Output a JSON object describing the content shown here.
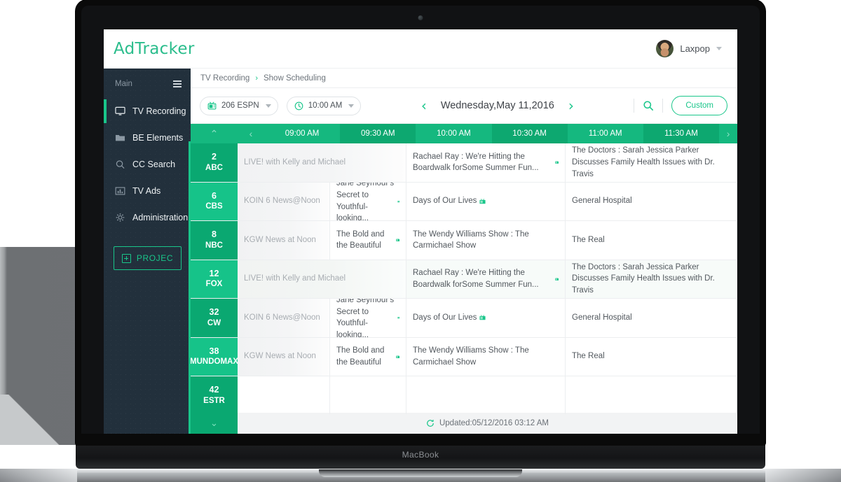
{
  "device": {
    "brand": "MacBook"
  },
  "topbar": {
    "logo": "AdTracker",
    "user_name": "Laxpop",
    "avatar_icon": "user-avatar-photo",
    "caret_icon": "chevron-down-icon"
  },
  "sidebar": {
    "section_label": "Main",
    "menu_icon": "hamburger-menu-icon",
    "items": [
      {
        "label": "TV Recording",
        "icon": "monitor-icon",
        "active": true
      },
      {
        "label": "BE Elements",
        "icon": "folder-icon",
        "active": false
      },
      {
        "label": "CC Search",
        "icon": "search-icon",
        "active": false
      },
      {
        "label": "TV Ads",
        "icon": "chart-bar-icon",
        "active": false
      },
      {
        "label": "Administration",
        "icon": "gear-icon",
        "active": false
      }
    ],
    "project_button": {
      "label": "PROJEC",
      "icon": "plus-box-icon"
    }
  },
  "breadcrumb": {
    "items": [
      "TV Recording",
      "Show Scheduling"
    ],
    "separator": "›"
  },
  "toolbar": {
    "channel_filter": {
      "value": "206 ESPN",
      "icon": "tv-icon",
      "caret": "chevron-down-icon"
    },
    "time_filter": {
      "value": "10:00 AM",
      "icon": "clock-icon",
      "caret": "chevron-down-icon"
    },
    "prev_icon": "chevron-left-icon",
    "next_icon": "chevron-right-icon",
    "date_label": "Wednesday,May 11,2016",
    "search_icon": "search-icon",
    "custom_button": "Custom"
  },
  "grid": {
    "collapse_icon": "chevron-up-icon",
    "expand_icon": "chevron-down-icon",
    "scroll_prev_icon": "chevron-left-icon",
    "scroll_next_icon": "chevron-right-icon",
    "time_slots": [
      "09:00 AM",
      "09:30 AM",
      "10:00 AM",
      "10:30 AM",
      "11:00 AM",
      "11:30 AM"
    ],
    "program_icon": "tv-badge-icon",
    "rows": [
      {
        "channel_number": "2",
        "channel_name": "ABC",
        "cells": [
          {
            "title": "LIVE! with Kelly and Michael",
            "past": true,
            "icon": false,
            "span": "a+b"
          },
          {
            "title": "Rachael Ray : We're Hitting the Boardwalk forSome Summer Fun...",
            "past": false,
            "icon": true,
            "span": "c"
          },
          {
            "title": "The Doctors : Sarah Jessica Parker Discusses Family Health Issues with Dr. Travis",
            "past": false,
            "icon": false,
            "span": "d"
          }
        ]
      },
      {
        "channel_number": "6",
        "channel_name": "CBS",
        "cells": [
          {
            "title": "KOIN 6 News@Noon",
            "past": true,
            "icon": false,
            "span": "a"
          },
          {
            "title": "Jane Seymour's Secret to Youthful-looking...",
            "past": false,
            "icon": true,
            "span": "b"
          },
          {
            "title": "Days of Our Lives",
            "past": false,
            "icon": true,
            "span": "c"
          },
          {
            "title": "General Hospital",
            "past": false,
            "icon": false,
            "span": "d"
          }
        ]
      },
      {
        "channel_number": "8",
        "channel_name": "NBC",
        "cells": [
          {
            "title": "KGW News at Noon",
            "past": true,
            "icon": false,
            "span": "a"
          },
          {
            "title": "The Bold and the Beautiful",
            "past": false,
            "icon": true,
            "span": "b"
          },
          {
            "title": "The Wendy Williams Show : The Carmichael Show",
            "past": false,
            "icon": false,
            "span": "c"
          },
          {
            "title": "The Real",
            "past": false,
            "icon": false,
            "span": "d"
          }
        ]
      },
      {
        "channel_number": "12",
        "channel_name": "FOX",
        "tint": true,
        "cells": [
          {
            "title": "LIVE! with Kelly and Michael",
            "past": true,
            "icon": false,
            "span": "a+b"
          },
          {
            "title": "Rachael Ray : We're Hitting the Boardwalk forSome Summer Fun...",
            "past": false,
            "icon": true,
            "span": "c"
          },
          {
            "title": "The Doctors : Sarah Jessica Parker Discusses Family Health Issues with Dr. Travis",
            "past": false,
            "icon": false,
            "span": "d"
          }
        ]
      },
      {
        "channel_number": "32",
        "channel_name": "CW",
        "cells": [
          {
            "title": "KOIN 6 News@Noon",
            "past": true,
            "icon": false,
            "span": "a"
          },
          {
            "title": "Jane Seymour's Secret to Youthful-looking...",
            "past": false,
            "icon": true,
            "span": "b"
          },
          {
            "title": "Days of Our Lives",
            "past": false,
            "icon": true,
            "span": "c"
          },
          {
            "title": "General Hospital",
            "past": false,
            "icon": false,
            "span": "d"
          }
        ]
      },
      {
        "channel_number": "38",
        "channel_name": "MUNDOMAX",
        "cells": [
          {
            "title": "KGW News at Noon",
            "past": true,
            "icon": false,
            "span": "a"
          },
          {
            "title": "The Bold and the Beautiful",
            "past": false,
            "icon": true,
            "span": "b"
          },
          {
            "title": "The Wendy Williams Show : The Carmichael Show",
            "past": false,
            "icon": false,
            "span": "c"
          },
          {
            "title": "The Real",
            "past": false,
            "icon": false,
            "span": "d"
          }
        ]
      },
      {
        "channel_number": "42",
        "channel_name": "ESTR",
        "cells": [
          {
            "title": "",
            "past": false,
            "icon": false,
            "span": "a"
          },
          {
            "title": "",
            "past": false,
            "icon": false,
            "span": "b"
          },
          {
            "title": "",
            "past": false,
            "icon": false,
            "span": "c"
          },
          {
            "title": "",
            "past": false,
            "icon": false,
            "span": "d"
          }
        ]
      }
    ],
    "footer": {
      "refresh_icon": "refresh-icon",
      "text": "Updated:05/12/2016 03:12 AM"
    }
  },
  "colors": {
    "brand_green": "#19c68a",
    "header_green": "#15b87f",
    "header_green_dark": "#0da870",
    "channel_green": "#0aa871",
    "channel_green_light": "#16c389",
    "sidebar_dark": "#22303c"
  }
}
